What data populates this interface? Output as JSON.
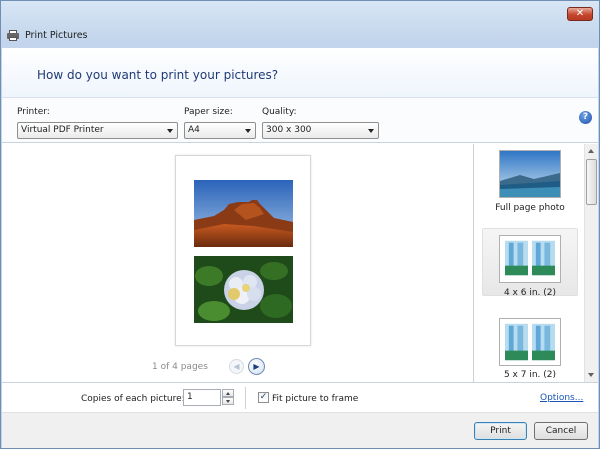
{
  "window": {
    "title": "Print Pictures",
    "close_glyph": "✕"
  },
  "header": {
    "prompt": "How do you want to print your pictures?"
  },
  "options": {
    "printer_label": "Printer:",
    "printer_value": "Virtual PDF Printer",
    "paper_label": "Paper size:",
    "paper_value": "A4",
    "quality_label": "Quality:",
    "quality_value": "300 x 300",
    "help_glyph": "?"
  },
  "preview": {
    "page_count": "1 of 4 pages",
    "prev_glyph": "◀",
    "next_glyph": "▶"
  },
  "layouts": {
    "items": [
      {
        "label": "Full page photo"
      },
      {
        "label": "4 x 6 in. (2)"
      },
      {
        "label": "5 x 7 in. (2)"
      }
    ],
    "selected_index": 1
  },
  "copies": {
    "label": "Copies of each picture:",
    "value": "1"
  },
  "fit": {
    "label": "Fit picture to frame",
    "checked": true,
    "check_glyph": "✓"
  },
  "options_link": "Options...",
  "buttons": {
    "print": "Print",
    "cancel": "Cancel"
  },
  "colors": {
    "title_blue": "#1f3a74",
    "link_blue": "#1a55b8",
    "close_red": "#c7452d"
  },
  "icons": {
    "app": "printer-icon",
    "help": "help-icon",
    "close": "close-icon"
  }
}
